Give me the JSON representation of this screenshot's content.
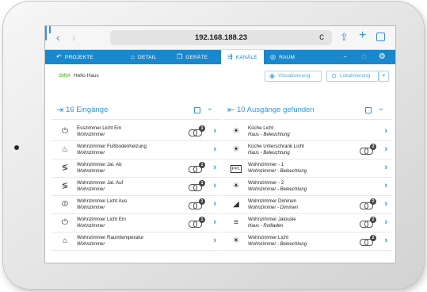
{
  "browser": {
    "url": "192.168.188.23",
    "back_glyph": "‹",
    "forward_glyph": "›",
    "reload_glyph": "c",
    "share_glyph": "⇪",
    "new_tab_glyph": "+",
    "accent": "#3b8ee6"
  },
  "app_nav": {
    "color": "#1a88cc",
    "items": [
      {
        "label": "Projekte",
        "icon": "back-arrow-icon",
        "glyph": "↶"
      },
      {
        "label": "Detail",
        "icon": "home-outline-icon",
        "glyph": "⌂"
      },
      {
        "label": "Geräte",
        "icon": "device-icon",
        "glyph": "❐"
      },
      {
        "label": "Kanäle",
        "icon": "channels-icon",
        "glyph": "⇶",
        "active": true
      },
      {
        "label": "Raum",
        "icon": "location-pin-icon",
        "glyph": "◎"
      }
    ],
    "right_icons": [
      {
        "icon": "link-icon",
        "glyph": "⇔"
      },
      {
        "icon": "document-icon",
        "glyph": "▢"
      },
      {
        "icon": "settings-gears-icon",
        "glyph": "⚙"
      }
    ]
  },
  "header": {
    "home_tag": "GIRA",
    "home_name": "Hello Haus",
    "visualisierung_label": "Visualisierung",
    "visualisierung_icon": "eye-icon",
    "lokalisierung_label": "Lokalisierung",
    "lokalisierung_icon": "locate-icon",
    "more_label": "▾"
  },
  "inputs": {
    "title": "16 Eingänge",
    "icon": "input-arrow-icon",
    "rows": [
      {
        "title": "Esszimmer Licht Ein",
        "subtitle": "Wohnzimmer",
        "icon": "power-on-icon",
        "glyph": "⏻",
        "links": 1
      },
      {
        "title": "Wohnzimmer Fußbodenheizung",
        "subtitle": "Wohnzimmer",
        "icon": "floor-heating-icon",
        "glyph": "♨",
        "links": 0
      },
      {
        "title": "Wohnzimmer Jal. Ab",
        "subtitle": "Wohnzimmer",
        "icon": "blind-down-icon",
        "glyph": "≶",
        "links": 1
      },
      {
        "title": "Wohnzimmer Jal. Auf",
        "subtitle": "Wohnzimmer",
        "icon": "blind-up-icon",
        "glyph": "≶",
        "links": 1
      },
      {
        "title": "Wohnzimmer Licht Aus",
        "subtitle": "Wohnzimmer",
        "icon": "power-off-icon",
        "glyph": "⏼",
        "links": 1
      },
      {
        "title": "Wohnzimmer Licht Ein",
        "subtitle": "Wohnzimmer",
        "icon": "power-on-icon",
        "glyph": "⏻",
        "links": 1
      },
      {
        "title": "Wohnzimmer Raumtemperatur",
        "subtitle": "Wohnzimmer",
        "icon": "room-temperature-icon",
        "glyph": "⌂",
        "links": 0
      }
    ]
  },
  "outputs": {
    "title": "10 Ausgänge gefunden",
    "icon": "output-arrow-icon",
    "rows": [
      {
        "title": "Küche Licht",
        "subtitle": "Haus - Beleuchtung",
        "icon": "light-icon",
        "glyph": "☀",
        "links": 0
      },
      {
        "title": "Küche Unterschrank Licht",
        "subtitle": "Haus - Beleuchtung",
        "icon": "light-icon",
        "glyph": "☀",
        "links": 2
      },
      {
        "title": "Wohnzimmer - 1",
        "subtitle": "Wohnzimmer - Beleuchtung",
        "icon": "ppl-icon",
        "glyph": "PPL",
        "links": 0
      },
      {
        "title": "Wohnzimmer - 2",
        "subtitle": "Wohnzimmer - Beleuchtung",
        "icon": "dimmer-light-icon",
        "glyph": "☀",
        "links": 0
      },
      {
        "title": "Wohnzimmer Dimmen",
        "subtitle": "Wohnzimmer - Dimmen",
        "icon": "dimming-icon",
        "glyph": "◢",
        "links": 2
      },
      {
        "title": "Wohnzimmer Jalousie",
        "subtitle": "Haus - Rollladen",
        "icon": "blind-icon",
        "glyph": "≡",
        "links": 2
      },
      {
        "title": "Wohnzimmer Licht",
        "subtitle": "Wohnzimmer - Beleuchtung",
        "icon": "light-icon",
        "glyph": "☀",
        "links": 2
      }
    ]
  }
}
